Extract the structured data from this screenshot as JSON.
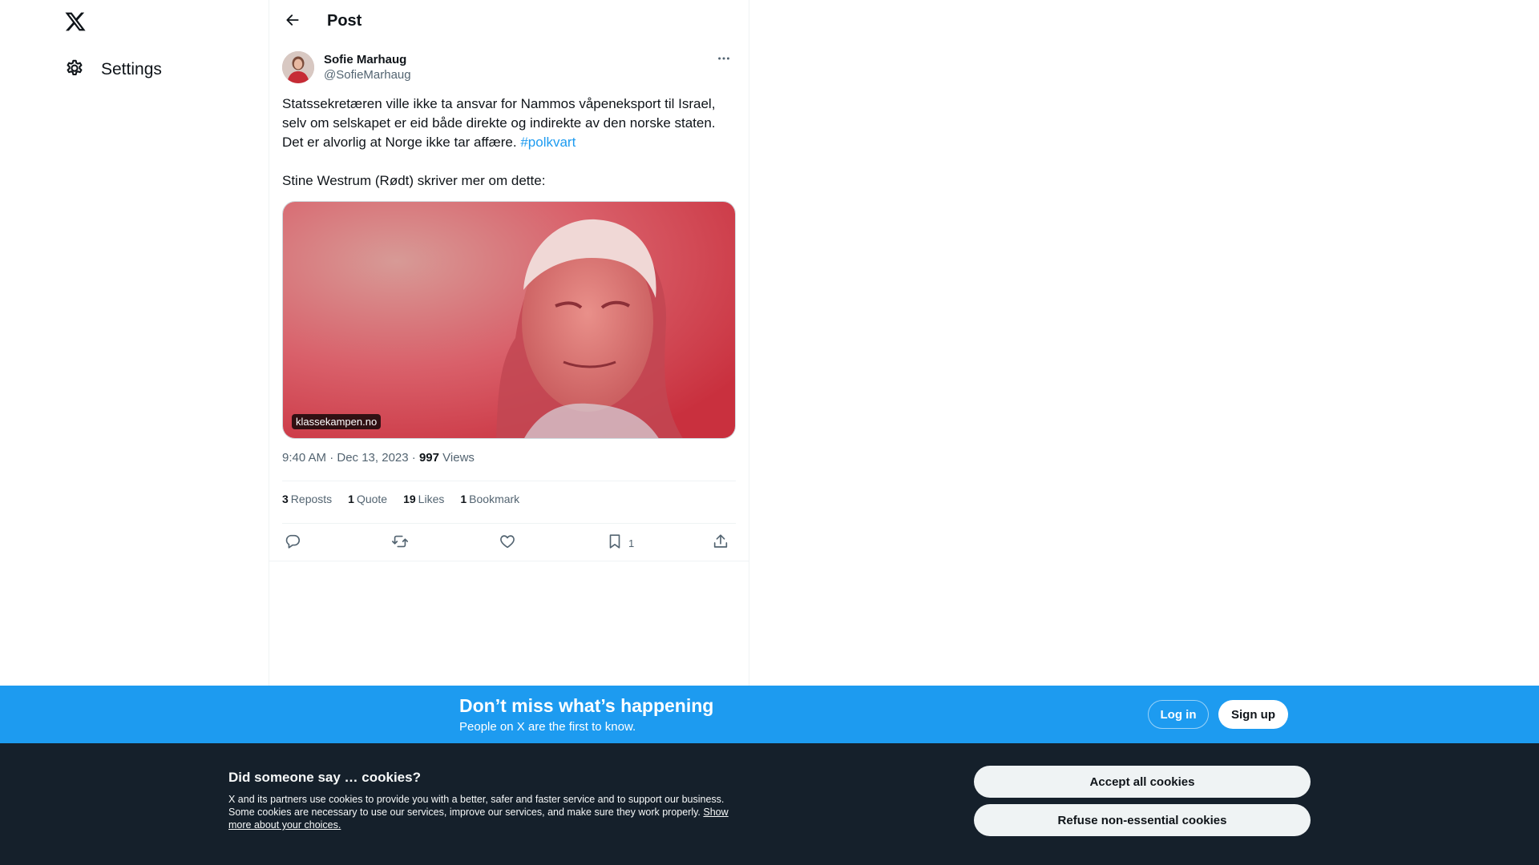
{
  "nav": {
    "logo_icon": "x-logo-icon",
    "settings_label": "Settings"
  },
  "header": {
    "title": "Post"
  },
  "tweet": {
    "display_name": "Sofie Marhaug",
    "handle": "@SofieMarhaug",
    "text_lines": [
      "Statssekretæren ville ikke ta ansvar for Nammos våpeneksport til Israel,",
      "selv om selskapet er eid både direkte og indirekte av den norske staten.",
      "Det er alvorlig at Norge ikke tar affære."
    ],
    "hashtag": "#polkvart",
    "text_after": "Stine Westrum (Rødt) skriver mer om dette:",
    "card_domain": "klassekampen.no",
    "time": "9:40 AM · Dec 13, 2023",
    "views_count": "997",
    "views_label": "Views",
    "separator": "·"
  },
  "stats": {
    "reposts_count": "3",
    "reposts_label": "Reposts",
    "quotes_count": "1",
    "quotes_label": "Quote",
    "likes_count": "19",
    "likes_label": "Likes",
    "bookmarks_count": "1",
    "bookmarks_label": "Bookmark"
  },
  "actions": {
    "bookmark_count": "1"
  },
  "banner": {
    "title": "Don’t miss what’s happening",
    "subtitle": "People on X are the first to know.",
    "login_label": "Log in",
    "signup_label": "Sign up",
    "color": "#1d9bf0"
  },
  "cookies": {
    "title": "Did someone say … cookies?",
    "body": "X and its partners use cookies to provide you with a better, safer and faster service and to support our business. Some cookies are necessary to use our services, improve our services, and make sure they work properly.",
    "link_label": "Show more about your choices.",
    "accept_label": "Accept all cookies",
    "refuse_label": "Refuse non-essential cookies",
    "background": "#15202b"
  }
}
